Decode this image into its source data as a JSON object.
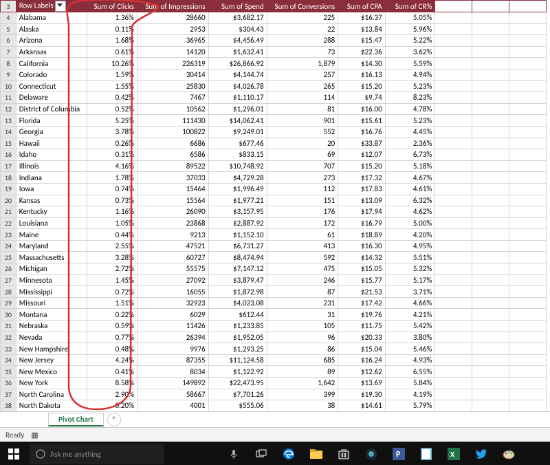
{
  "header": {
    "row_labels": "Row Labels",
    "cols": [
      "Sum of Clicks",
      "Sum of Impressions",
      "Sum of Spend",
      "Sum of Conversions",
      "Sum of CPA",
      "Sum of CR%"
    ]
  },
  "rows": [
    {
      "n": 4,
      "s": "Alabama",
      "c": "1.36%",
      "i": "28660",
      "sp": "$3,682.17",
      "cv": "225",
      "cpa": "$16.37",
      "cr": "5.05%"
    },
    {
      "n": 5,
      "s": "Alaska",
      "c": "0.11%",
      "i": "2953",
      "sp": "$304.43",
      "cv": "22",
      "cpa": "$13.84",
      "cr": "5.96%"
    },
    {
      "n": 6,
      "s": "Arizona",
      "c": "1.68%",
      "i": "36965",
      "sp": "$4,456.49",
      "cv": "288",
      "cpa": "$15.47",
      "cr": "5.22%"
    },
    {
      "n": 7,
      "s": "Arkansas",
      "c": "0.61%",
      "i": "14120",
      "sp": "$1,632.41",
      "cv": "73",
      "cpa": "$22.36",
      "cr": "3.62%"
    },
    {
      "n": 8,
      "s": "California",
      "c": "10.26%",
      "i": "226319",
      "sp": "$26,866.92",
      "cv": "1,879",
      "cpa": "$14.30",
      "cr": "5.59%"
    },
    {
      "n": 9,
      "s": "Colorado",
      "c": "1.59%",
      "i": "30414",
      "sp": "$4,144.74",
      "cv": "257",
      "cpa": "$16.13",
      "cr": "4.94%"
    },
    {
      "n": 10,
      "s": "Connecticut",
      "c": "1.55%",
      "i": "25830",
      "sp": "$4,026.78",
      "cv": "265",
      "cpa": "$15.20",
      "cr": "5.23%"
    },
    {
      "n": 11,
      "s": "Delaware",
      "c": "0.42%",
      "i": "7467",
      "sp": "$1,110.17",
      "cv": "114",
      "cpa": "$9.74",
      "cr": "8.23%"
    },
    {
      "n": 12,
      "s": "District of Columbia",
      "c": "0.52%",
      "i": "10562",
      "sp": "$1,296.01",
      "cv": "81",
      "cpa": "$16.00",
      "cr": "4.78%"
    },
    {
      "n": 13,
      "s": "Florida",
      "c": "5.25%",
      "i": "111430",
      "sp": "$14,062.41",
      "cv": "901",
      "cpa": "$15.61",
      "cr": "5.23%"
    },
    {
      "n": 14,
      "s": "Georgia",
      "c": "3.78%",
      "i": "100822",
      "sp": "$9,249.01",
      "cv": "552",
      "cpa": "$16.76",
      "cr": "4.45%"
    },
    {
      "n": 15,
      "s": "Hawaii",
      "c": "0.26%",
      "i": "6686",
      "sp": "$677.46",
      "cv": "20",
      "cpa": "$33.87",
      "cr": "2.36%"
    },
    {
      "n": 16,
      "s": "Idaho",
      "c": "0.31%",
      "i": "6586",
      "sp": "$833.15",
      "cv": "69",
      "cpa": "$12.07",
      "cr": "6.73%"
    },
    {
      "n": 17,
      "s": "Illinois",
      "c": "4.16%",
      "i": "89522",
      "sp": "$10,748.92",
      "cv": "707",
      "cpa": "$15.20",
      "cr": "5.18%"
    },
    {
      "n": 18,
      "s": "Indiana",
      "c": "1.78%",
      "i": "37033",
      "sp": "$4,729.28",
      "cv": "273",
      "cpa": "$17.32",
      "cr": "4.67%"
    },
    {
      "n": 19,
      "s": "Iowa",
      "c": "0.74%",
      "i": "15464",
      "sp": "$1,996.49",
      "cv": "112",
      "cpa": "$17.83",
      "cr": "4.61%"
    },
    {
      "n": 20,
      "s": "Kansas",
      "c": "0.73%",
      "i": "15564",
      "sp": "$1,977.21",
      "cv": "151",
      "cpa": "$13.09",
      "cr": "6.32%"
    },
    {
      "n": 21,
      "s": "Kentucky",
      "c": "1.16%",
      "i": "26090",
      "sp": "$3,157.95",
      "cv": "176",
      "cpa": "$17.94",
      "cr": "4.62%"
    },
    {
      "n": 22,
      "s": "Louisiana",
      "c": "1.05%",
      "i": "23868",
      "sp": "$2,887.92",
      "cv": "172",
      "cpa": "$16.79",
      "cr": "5.00%"
    },
    {
      "n": 23,
      "s": "Maine",
      "c": "0.44%",
      "i": "9213",
      "sp": "$1,152.10",
      "cv": "61",
      "cpa": "$18.89",
      "cr": "4.20%"
    },
    {
      "n": 24,
      "s": "Maryland",
      "c": "2.55%",
      "i": "47521",
      "sp": "$6,731.27",
      "cv": "413",
      "cpa": "$16.30",
      "cr": "4.95%"
    },
    {
      "n": 25,
      "s": "Massachusetts",
      "c": "3.28%",
      "i": "60727",
      "sp": "$8,474.94",
      "cv": "592",
      "cpa": "$14.32",
      "cr": "5.51%"
    },
    {
      "n": 26,
      "s": "Michigan",
      "c": "2.72%",
      "i": "55575",
      "sp": "$7,147.12",
      "cv": "475",
      "cpa": "$15.05",
      "cr": "5.32%"
    },
    {
      "n": 27,
      "s": "Minnesota",
      "c": "1.45%",
      "i": "27092",
      "sp": "$3,879.47",
      "cv": "246",
      "cpa": "$15.77",
      "cr": "5.17%"
    },
    {
      "n": 28,
      "s": "Mississippi",
      "c": "0.72%",
      "i": "16055",
      "sp": "$1,872.98",
      "cv": "87",
      "cpa": "$21.53",
      "cr": "3.71%"
    },
    {
      "n": 29,
      "s": "Missouri",
      "c": "1.51%",
      "i": "32923",
      "sp": "$4,023.08",
      "cv": "231",
      "cpa": "$17.42",
      "cr": "4.66%"
    },
    {
      "n": 30,
      "s": "Montana",
      "c": "0.22%",
      "i": "6029",
      "sp": "$612.44",
      "cv": "31",
      "cpa": "$19.76",
      "cr": "4.21%"
    },
    {
      "n": 31,
      "s": "Nebraska",
      "c": "0.59%",
      "i": "11426",
      "sp": "$1,233.85",
      "cv": "105",
      "cpa": "$11.75",
      "cr": "5.42%"
    },
    {
      "n": 32,
      "s": "Nevada",
      "c": "0.77%",
      "i": "26394",
      "sp": "$1,952.05",
      "cv": "96",
      "cpa": "$20.33",
      "cr": "3.80%"
    },
    {
      "n": 33,
      "s": "New Hampshire",
      "c": "0.48%",
      "i": "9976",
      "sp": "$1,293.25",
      "cv": "86",
      "cpa": "$15.04",
      "cr": "5.46%"
    },
    {
      "n": 34,
      "s": "New Jersey",
      "c": "4.24%",
      "i": "87355",
      "sp": "$11,124.58",
      "cv": "685",
      "cpa": "$16.24",
      "cr": "4.93%"
    },
    {
      "n": 35,
      "s": "New Mexico",
      "c": "0.41%",
      "i": "8034",
      "sp": "$1,122.92",
      "cv": "89",
      "cpa": "$12.62",
      "cr": "6.55%"
    },
    {
      "n": 36,
      "s": "New York",
      "c": "8.58%",
      "i": "149892",
      "sp": "$22,473.95",
      "cv": "1,642",
      "cpa": "$13.69",
      "cr": "5.84%"
    },
    {
      "n": 37,
      "s": "North Carolina",
      "c": "2.90%",
      "i": "58667",
      "sp": "$7,701.26",
      "cv": "399",
      "cpa": "$19.30",
      "cr": "4.19%"
    },
    {
      "n": 38,
      "s": "North Dakota",
      "c": "0.20%",
      "i": "4001",
      "sp": "$555.06",
      "cv": "38",
      "cpa": "$14.61",
      "cr": "5.79%"
    }
  ],
  "tabs": {
    "active": "Pivot Chart"
  },
  "status": {
    "ready": "Ready"
  },
  "taskbar": {
    "search_placeholder": "Ask me anything"
  }
}
